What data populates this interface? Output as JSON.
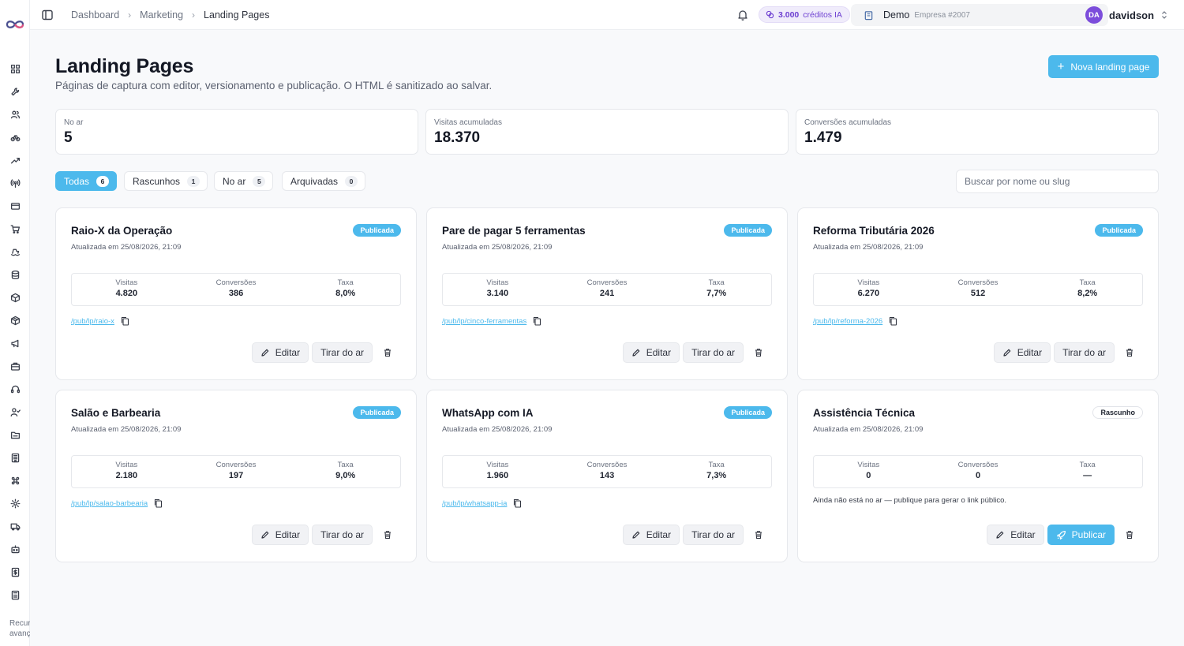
{
  "sidebar": {
    "icons": [
      "grid-icon",
      "wrench-icon",
      "users-icon",
      "bike-icon",
      "trending-up-icon",
      "broadcast-icon",
      "credit-card-icon",
      "cart-icon",
      "ship-icon",
      "database-icon",
      "box-icon",
      "package-icon",
      "megaphone-icon",
      "briefcase-icon",
      "headset-icon",
      "team-icon",
      "folder-icon",
      "building-icon",
      "command-icon",
      "settings-icon",
      "truck-icon",
      "robot-icon",
      "invoice-icon",
      "calculator-icon"
    ],
    "footer_line1": "Recursos",
    "footer_line2": "avançados"
  },
  "topbar": {
    "breadcrumb": [
      "Dashboard",
      "Marketing",
      "Landing Pages"
    ],
    "credits_value": "3.000",
    "credits_label": "créditos IA",
    "company_name": "Demo",
    "company_sub": "Empresa #2007",
    "user_initials": "DA",
    "user_name": "davidson"
  },
  "header": {
    "title": "Landing Pages",
    "subtitle": "Páginas de captura com editor, versionamento e publicação. O HTML é sanitizado ao salvar.",
    "new_button": "Nova landing page"
  },
  "stats": [
    {
      "label": "No ar",
      "value": "5"
    },
    {
      "label": "Visitas acumuladas",
      "value": "18.370"
    },
    {
      "label": "Conversões acumuladas",
      "value": "1.479"
    }
  ],
  "filters": [
    {
      "label": "Todas",
      "count": "6",
      "active": true
    },
    {
      "label": "Rascunhos",
      "count": "1",
      "active": false
    },
    {
      "label": "No ar",
      "count": "5",
      "active": false
    },
    {
      "label": "Arquivadas",
      "count": "0",
      "active": false
    }
  ],
  "search": {
    "placeholder": "Buscar por nome ou slug"
  },
  "metric_labels": {
    "visits": "Visitas",
    "conversions": "Conversões",
    "rate": "Taxa"
  },
  "buttons": {
    "edit": "Editar",
    "unpublish": "Tirar do ar",
    "publish": "Publicar"
  },
  "cards": [
    {
      "name": "Raio-X da Operação",
      "updated": "Atualizada em 25/08/2026, 21:09",
      "status": "Publicada",
      "visits": "4.820",
      "conversions": "386",
      "rate": "8,0%",
      "slug": "/pub/lp/raio-x"
    },
    {
      "name": "Pare de pagar 5 ferramentas",
      "updated": "Atualizada em 25/08/2026, 21:09",
      "status": "Publicada",
      "visits": "3.140",
      "conversions": "241",
      "rate": "7,7%",
      "slug": "/pub/lp/cinco-ferramentas"
    },
    {
      "name": "Reforma Tributária 2026",
      "updated": "Atualizada em 25/08/2026, 21:09",
      "status": "Publicada",
      "visits": "6.270",
      "conversions": "512",
      "rate": "8,2%",
      "slug": "/pub/lp/reforma-2026"
    },
    {
      "name": "Salão e Barbearia",
      "updated": "Atualizada em 25/08/2026, 21:09",
      "status": "Publicada",
      "visits": "2.180",
      "conversions": "197",
      "rate": "9,0%",
      "slug": "/pub/lp/salao-barbearia"
    },
    {
      "name": "WhatsApp com IA",
      "updated": "Atualizada em 25/08/2026, 21:09",
      "status": "Publicada",
      "visits": "1.960",
      "conversions": "143",
      "rate": "7,3%",
      "slug": "/pub/lp/whatsapp-ia"
    },
    {
      "name": "Assistência Técnica",
      "updated": "Atualizada em 25/08/2026, 21:09",
      "status": "Rascunho",
      "visits": "0",
      "conversions": "0",
      "rate": "—",
      "note": "Ainda não está no ar — publique para gerar o link público."
    }
  ],
  "colors": {
    "accent": "#4cb9ec",
    "credits": "#6d3fd1",
    "avatar": "#7c4ddb"
  }
}
